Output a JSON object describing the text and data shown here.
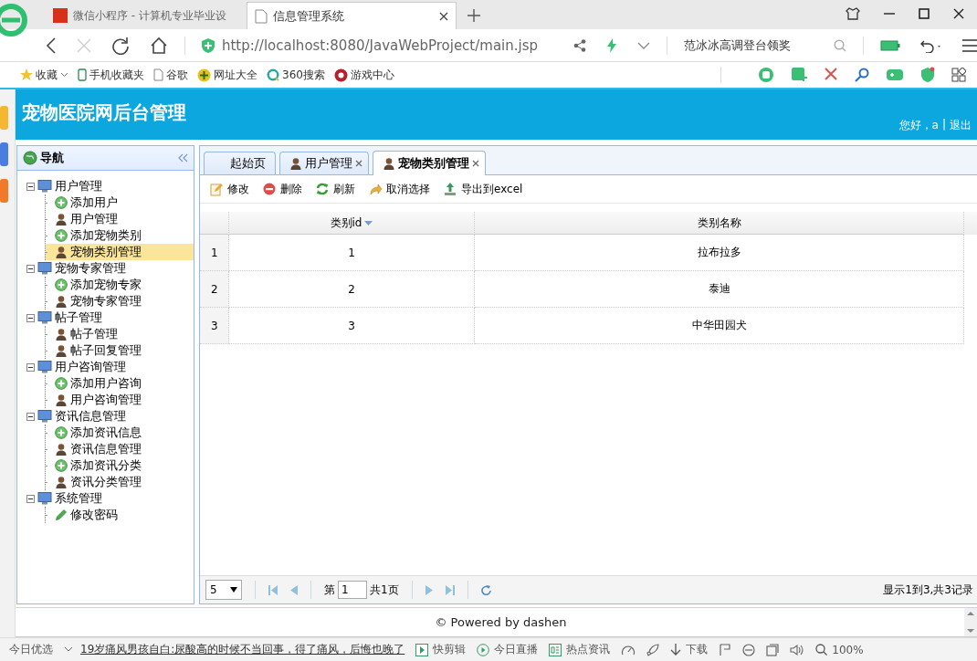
{
  "browser": {
    "tabs": [
      {
        "title": "微信小程序 - 计算机专业毕业设",
        "kind": "site",
        "selected": false
      },
      {
        "title": "信息管理系统",
        "kind": "page",
        "selected": true
      }
    ],
    "url": "http://localhost:8080/JavaWebProject/main.jsp",
    "search_text": "范冰冰高调登台领奖",
    "bookmarks": [
      {
        "label": "收藏",
        "kind": "star"
      },
      {
        "label": "手机收藏夹",
        "kind": "phone"
      },
      {
        "label": "谷歌",
        "kind": "doc"
      },
      {
        "label": "网址大全",
        "kind": "globe"
      },
      {
        "label": "360搜索",
        "kind": "ring"
      },
      {
        "label": "游戏中心",
        "kind": "game"
      }
    ]
  },
  "app": {
    "title": "宠物医院网后台管理",
    "greeting": "您好，a",
    "separator": "|",
    "logout": "退出"
  },
  "nav": {
    "title": "导航",
    "tree": [
      {
        "label": "用户管理",
        "expanded": true,
        "children": [
          {
            "label": "添加用户",
            "kind": "add",
            "selected": false
          },
          {
            "label": "用户管理",
            "kind": "user",
            "selected": false
          },
          {
            "label": "添加宠物类别",
            "kind": "add",
            "selected": false
          },
          {
            "label": "宠物类别管理",
            "kind": "user",
            "selected": true
          }
        ]
      },
      {
        "label": "宠物专家管理",
        "expanded": true,
        "children": [
          {
            "label": "添加宠物专家",
            "kind": "add",
            "selected": false
          },
          {
            "label": "宠物专家管理",
            "kind": "user",
            "selected": false
          }
        ]
      },
      {
        "label": "帖子管理",
        "expanded": true,
        "children": [
          {
            "label": "帖子管理",
            "kind": "user",
            "selected": false
          },
          {
            "label": "帖子回复管理",
            "kind": "user",
            "selected": false
          }
        ]
      },
      {
        "label": "用户咨询管理",
        "expanded": true,
        "children": [
          {
            "label": "添加用户咨询",
            "kind": "add",
            "selected": false
          },
          {
            "label": "用户咨询管理",
            "kind": "user",
            "selected": false
          }
        ]
      },
      {
        "label": "资讯信息管理",
        "expanded": true,
        "children": [
          {
            "label": "添加资讯信息",
            "kind": "add",
            "selected": false
          },
          {
            "label": "资讯信息管理",
            "kind": "user",
            "selected": false
          },
          {
            "label": "添加资讯分类",
            "kind": "add",
            "selected": false
          },
          {
            "label": "资讯分类管理",
            "kind": "user",
            "selected": false
          }
        ]
      },
      {
        "label": "系统管理",
        "expanded": true,
        "children": [
          {
            "label": "修改密码",
            "kind": "edit",
            "selected": false
          }
        ]
      }
    ]
  },
  "tabs": [
    {
      "label": "起始页",
      "icon": false,
      "closable": false,
      "selected": false
    },
    {
      "label": "用户管理",
      "icon": true,
      "closable": true,
      "selected": false
    },
    {
      "label": "宠物类别管理",
      "icon": true,
      "closable": true,
      "selected": true
    }
  ],
  "toolbar": [
    {
      "label": "修改",
      "kind": "edit"
    },
    {
      "label": "删除",
      "kind": "delete"
    },
    {
      "label": "刷新",
      "kind": "refresh"
    },
    {
      "label": "取消选择",
      "kind": "undo"
    },
    {
      "label": "导出到excel",
      "kind": "export"
    }
  ],
  "table": {
    "columns": [
      {
        "label": "类别id",
        "sorted": true
      },
      {
        "label": "类别名称",
        "sorted": false
      }
    ],
    "rows": [
      {
        "number": "1",
        "cells": [
          "1",
          "拉布拉多"
        ]
      },
      {
        "number": "2",
        "cells": [
          "2",
          "泰迪"
        ]
      },
      {
        "number": "3",
        "cells": [
          "3",
          "中华田园犬"
        ]
      }
    ]
  },
  "pager": {
    "page_size": "5",
    "page_prefix": "第",
    "page": "1",
    "page_total": "共1页",
    "summary": "显示1到3,共3记录"
  },
  "footer": "© Powered by dashen",
  "status_bar": {
    "items": [
      {
        "kind": "text",
        "label": "今日优选"
      },
      {
        "kind": "chevron"
      },
      {
        "kind": "news",
        "label": "19岁痛风男孩自白:尿酸高的时候不当回事，得了痛风，后悔也晚了"
      },
      {
        "kind": "clip",
        "label": "快剪辑"
      },
      {
        "kind": "live",
        "label": "今日直播"
      },
      {
        "kind": "hot",
        "label": "热点资讯"
      },
      {
        "kind": "speed"
      },
      {
        "kind": "rocket"
      },
      {
        "kind": "download",
        "label": "下载"
      },
      {
        "kind": "flag"
      },
      {
        "kind": "ie"
      },
      {
        "kind": "window"
      },
      {
        "kind": "sound"
      },
      {
        "kind": "zoom",
        "label": "100%"
      }
    ]
  }
}
